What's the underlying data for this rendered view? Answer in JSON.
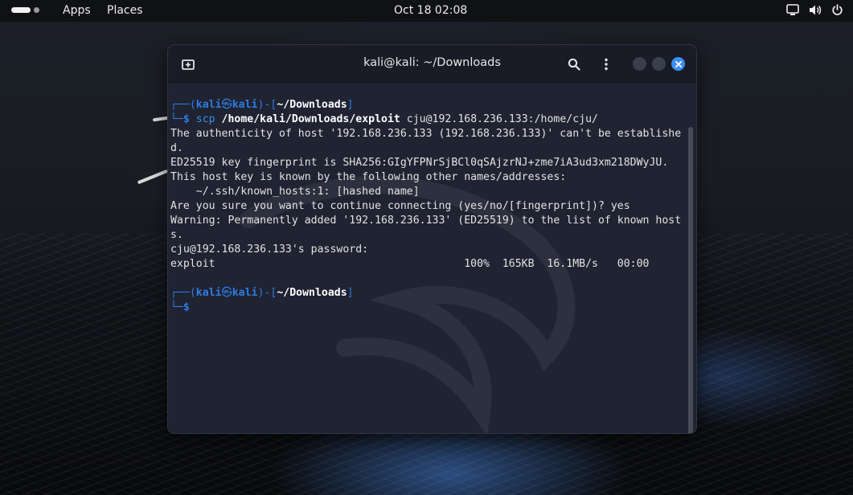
{
  "topbar": {
    "apps_label": "Apps",
    "places_label": "Places",
    "clock": "Oct 18  02:08"
  },
  "window": {
    "title": "kali@kali: ~/Downloads"
  },
  "terminal": {
    "prompt1": {
      "corner_top": "┌──(",
      "user": "kali",
      "at_symbol": "㉿",
      "host": "kali",
      "sep": ")-[",
      "cwd": "~/Downloads",
      "close": "]",
      "corner_bottom": "└─",
      "dollar": "$ ",
      "cmd": "scp",
      "arg1": " /home/kali/Downloads/exploit",
      "arg2": " cju@192.168.236.133:/home/cju/"
    },
    "output": [
      "The authenticity of host '192.168.236.133 (192.168.236.133)' can't be establishe",
      "d.",
      "ED25519 key fingerprint is SHA256:GIgYFPNrSjBCl0qSAjzrNJ+zme7iA3ud3xm218DWyJU.",
      "This host key is known by the following other names/addresses:",
      "    ~/.ssh/known_hosts:1: [hashed name]",
      "Are you sure you want to continue connecting (yes/no/[fingerprint])? yes",
      "Warning: Permanently added '192.168.236.133' (ED25519) to the list of known host",
      "s.",
      "cju@192.168.236.133's password: ",
      "exploit                                       100%  165KB  16.1MB/s   00:00"
    ],
    "prompt2": {
      "corner_top": "┌──(",
      "user": "kali",
      "at_symbol": "㉿",
      "host": "kali",
      "sep": ")-[",
      "cwd": "~/Downloads",
      "close": "]",
      "corner_bottom": "└─",
      "dollar": "$"
    }
  },
  "icons": {
    "new_tab": "new-tab-icon",
    "search": "search-icon",
    "menu": "kebab-menu-icon",
    "close": "close-icon",
    "screen": "screen-icon",
    "volume": "volume-icon",
    "power": "power-icon"
  },
  "colors": {
    "prompt_blue": "#2f7be0",
    "close_button": "#3b8ef3",
    "terminal_bg": "#1f2332"
  }
}
